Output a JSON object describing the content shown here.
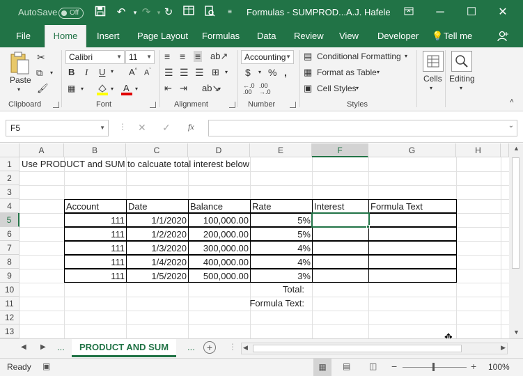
{
  "titlebar": {
    "autosave_label": "AutoSave",
    "autosave_state": "Off",
    "doc_title": "Formulas - SUMPROD...",
    "user": "A.J. Hafele",
    "icons": [
      "save-icon",
      "undo-icon",
      "redo-icon",
      "refresh-icon",
      "form-icon",
      "print-preview-icon",
      "customize-qat-icon"
    ]
  },
  "tabs": [
    {
      "label": "File"
    },
    {
      "label": "Home"
    },
    {
      "label": "Insert"
    },
    {
      "label": "Page Layout"
    },
    {
      "label": "Formulas"
    },
    {
      "label": "Data"
    },
    {
      "label": "Review"
    },
    {
      "label": "View"
    },
    {
      "label": "Developer"
    },
    {
      "label": "Tell me"
    }
  ],
  "ribbon": {
    "clipboard": {
      "label": "Clipboard",
      "paste": "Paste"
    },
    "font": {
      "label": "Font",
      "family": "Calibri",
      "size": "11"
    },
    "alignment": {
      "label": "Alignment"
    },
    "number": {
      "label": "Number",
      "format": "Accounting"
    },
    "styles": {
      "label": "Styles",
      "conditional": "Conditional Formatting",
      "format_table": "Format as Table",
      "cell_styles": "Cell Styles"
    },
    "cells": {
      "label": "Cells"
    },
    "editing": {
      "label": "Editing"
    }
  },
  "formula_bar": {
    "name_box": "F5",
    "formula": ""
  },
  "sheet": {
    "columns": [
      "A",
      "B",
      "C",
      "D",
      "E",
      "F",
      "G",
      "H"
    ],
    "rows": [
      "1",
      "2",
      "3",
      "4",
      "5",
      "6",
      "7",
      "8",
      "9",
      "10",
      "11",
      "12",
      "13"
    ],
    "selected_cell": "F5",
    "a1": "Use PRODUCT and SUM to calcuate total interest below",
    "headers": [
      "Account",
      "Date",
      "Balance",
      "Rate",
      "Interest",
      "Formula Text"
    ],
    "data": [
      [
        "111",
        "1/1/2020",
        "100,000.00",
        "5%",
        "",
        ""
      ],
      [
        "111",
        "1/2/2020",
        "200,000.00",
        "5%",
        "",
        ""
      ],
      [
        "111",
        "1/3/2020",
        "300,000.00",
        "4%",
        "",
        ""
      ],
      [
        "111",
        "1/4/2020",
        "400,000.00",
        "4%",
        "",
        ""
      ],
      [
        "111",
        "1/5/2020",
        "500,000.00",
        "3%",
        "",
        ""
      ]
    ],
    "total_label": "Total:",
    "formula_text_label": "Formula Text:"
  },
  "sheet_tabs": {
    "active": "PRODUCT AND SUM",
    "more_left": "...",
    "more_right": "..."
  },
  "status": {
    "mode": "Ready",
    "zoom": "100%"
  }
}
